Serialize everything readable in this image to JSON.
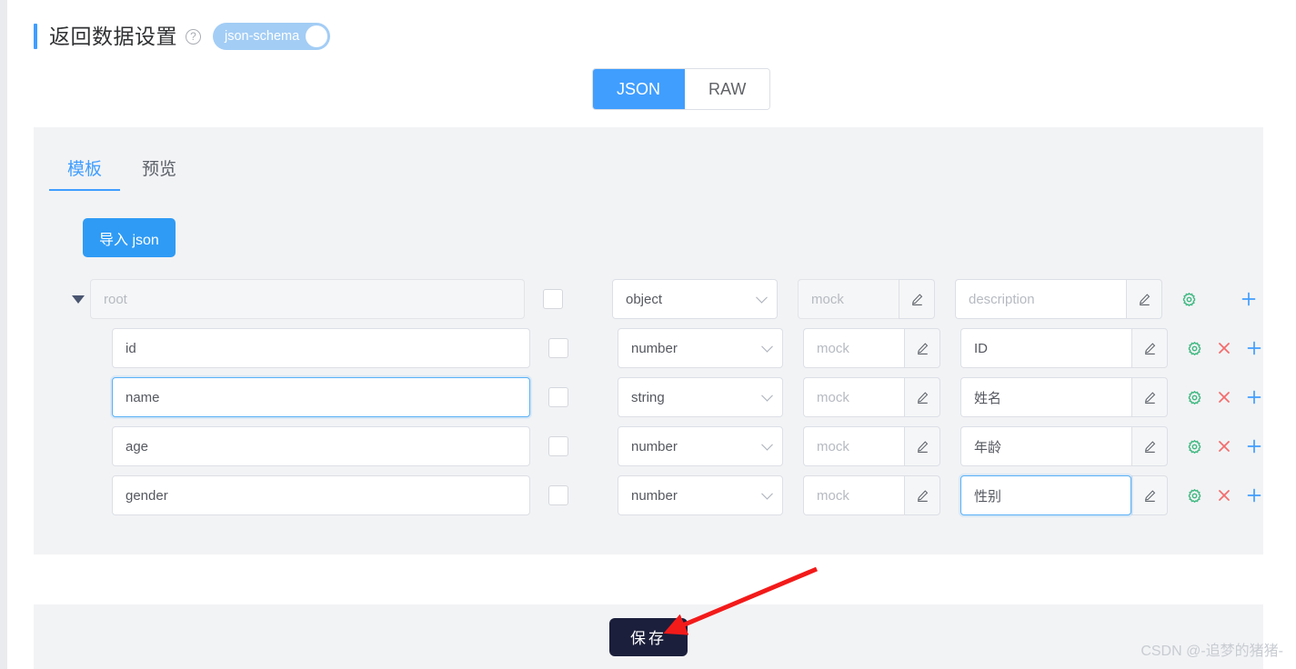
{
  "header": {
    "title": "返回数据设置",
    "help_icon": "question-mark-icon",
    "schema_toggle_label": "json-schema",
    "schema_toggle_on": true,
    "accent_color": "#409eff",
    "toggle_color": "#a3cdf5"
  },
  "format_switch": {
    "options": [
      {
        "label": "JSON",
        "active": true
      },
      {
        "label": "RAW",
        "active": false
      }
    ]
  },
  "panel": {
    "tabs": [
      {
        "label": "模板",
        "active": true
      },
      {
        "label": "预览",
        "active": false
      }
    ],
    "import_button_label": "导入 json"
  },
  "placeholders": {
    "mock": "mock",
    "description": "description",
    "field_name": "root"
  },
  "rows": [
    {
      "name": "root",
      "name_disabled": true,
      "name_focused": false,
      "required_checked": false,
      "type": "object",
      "mock": "",
      "mock_disabled": true,
      "description": "",
      "description_focused": false,
      "indent": 0,
      "has_caret": true,
      "has_delete": false
    },
    {
      "name": "id",
      "name_disabled": false,
      "name_focused": false,
      "required_checked": false,
      "type": "number",
      "mock": "",
      "mock_disabled": false,
      "description": "ID",
      "description_focused": false,
      "indent": 1,
      "has_caret": false,
      "has_delete": true
    },
    {
      "name": "name",
      "name_disabled": false,
      "name_focused": true,
      "required_checked": false,
      "type": "string",
      "mock": "",
      "mock_disabled": false,
      "description": "姓名",
      "description_focused": false,
      "indent": 1,
      "has_caret": false,
      "has_delete": true
    },
    {
      "name": "age",
      "name_disabled": false,
      "name_focused": false,
      "required_checked": false,
      "type": "number",
      "mock": "",
      "mock_disabled": false,
      "description": "年龄",
      "description_focused": false,
      "indent": 1,
      "has_caret": false,
      "has_delete": true
    },
    {
      "name": "gender",
      "name_disabled": false,
      "name_focused": false,
      "required_checked": false,
      "type": "number",
      "mock": "",
      "mock_disabled": false,
      "description": "性别",
      "description_focused": true,
      "indent": 1,
      "has_caret": false,
      "has_delete": true
    }
  ],
  "icons": {
    "edit": "pencil-icon",
    "settings": "gear-icon",
    "delete": "close-x-icon",
    "add": "plus-icon",
    "gear_color": "#42b983",
    "delete_color": "#f56c6c",
    "add_color": "#409eff"
  },
  "footer": {
    "save_label": "保存"
  },
  "watermark": "CSDN @-追梦的猪猪-"
}
